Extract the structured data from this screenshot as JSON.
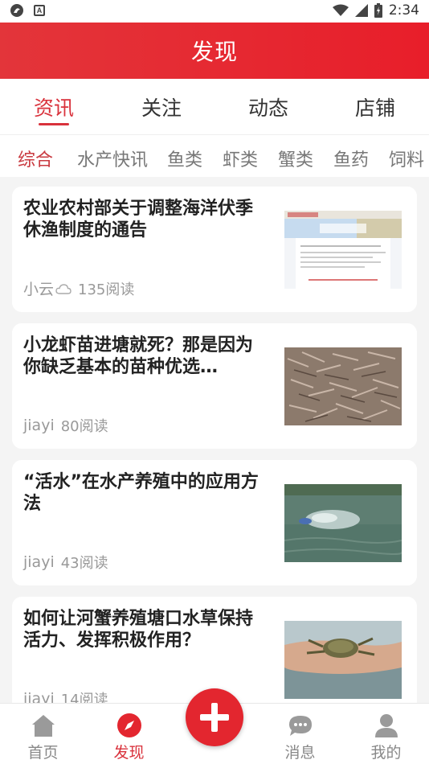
{
  "status_bar": {
    "time": "2:34",
    "left_icons": [
      "app-notification-icon",
      "a-letter-icon"
    ],
    "right_icons": [
      "wifi-icon",
      "signal-icon",
      "battery-icon"
    ]
  },
  "header": {
    "title": "发现"
  },
  "main_tabs": [
    {
      "label": "资讯",
      "active": true
    },
    {
      "label": "关注",
      "active": false
    },
    {
      "label": "动态",
      "active": false
    },
    {
      "label": "店铺",
      "active": false
    }
  ],
  "sub_tabs": [
    {
      "label": "综合",
      "active": true
    },
    {
      "label": "水产快讯",
      "active": false
    },
    {
      "label": "鱼类",
      "active": false
    },
    {
      "label": "虾类",
      "active": false
    },
    {
      "label": "蟹类",
      "active": false
    },
    {
      "label": "鱼药",
      "active": false
    },
    {
      "label": "饲料",
      "active": false
    }
  ],
  "articles": [
    {
      "title": "农业农村部关于调整海洋伏季休渔制度的通告",
      "author": "小云",
      "author_icon": "cloud-icon",
      "reads": "135阅读",
      "thumb": "government-document-thumbnail"
    },
    {
      "title": "小龙虾苗进塘就死？那是因为你缺乏基本的苗种优选…",
      "author": "jiayi",
      "reads": "80阅读",
      "thumb": "crayfish-thumbnail"
    },
    {
      "title": "“活水”在水产养殖中的应用方法",
      "author": "jiayi",
      "reads": "43阅读",
      "thumb": "pond-aerator-thumbnail"
    },
    {
      "title": "如何让河蟹养殖塘口水草保持活力、发挥积极作用？",
      "author": "jiayi",
      "reads": "14阅读",
      "thumb": "crab-in-hand-thumbnail"
    }
  ],
  "bottom_nav": [
    {
      "label": "首页",
      "icon": "home-icon",
      "active": false
    },
    {
      "label": "发现",
      "icon": "compass-icon",
      "active": true
    },
    {
      "label": "消息",
      "icon": "chat-bubble-icon",
      "active": false
    },
    {
      "label": "我的",
      "icon": "user-icon",
      "active": false
    }
  ],
  "fab": {
    "icon": "plus-icon"
  },
  "colors": {
    "accent": "#e3262f",
    "header_gradient": [
      "#e3353a",
      "#e81e2a"
    ],
    "active_text": "#d9323c"
  }
}
